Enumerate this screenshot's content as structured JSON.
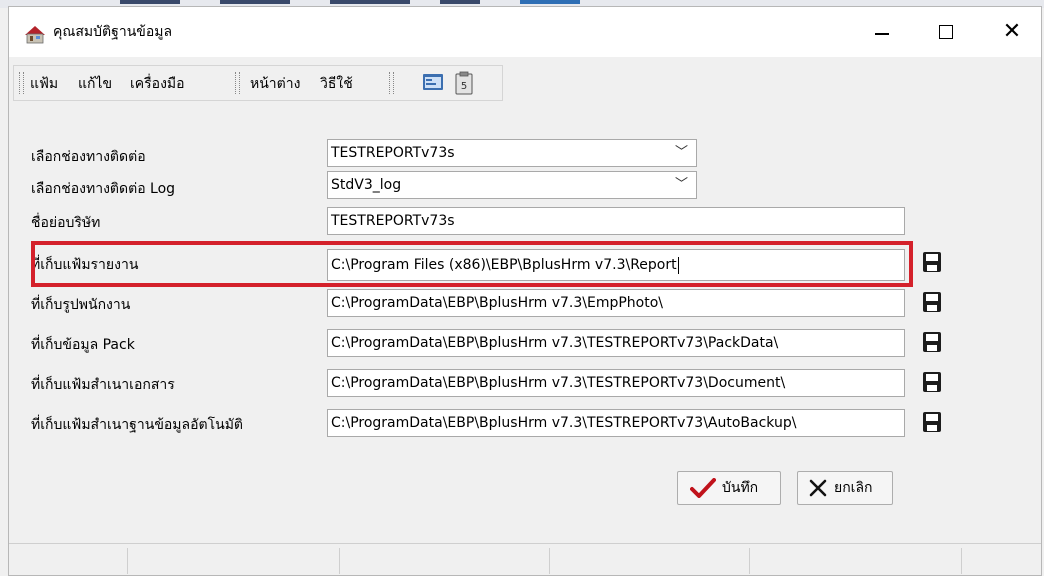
{
  "window": {
    "title": "คุณสมบัติฐานข้อมูล"
  },
  "menu": {
    "items": [
      "แฟ้ม",
      "แก้ไข",
      "เครื่องมือ",
      "หน้าต่าง",
      "วิธีใช้"
    ],
    "icons": [
      "window-icon",
      "clipboard-icon"
    ]
  },
  "form": {
    "connection": {
      "label": "เลือกช่องทางติดต่อ",
      "value": "TESTREPORTv73s"
    },
    "log_connection": {
      "label": "เลือกช่องทางติดต่อ Log",
      "value": "StdV3_log"
    },
    "company_short_name": {
      "label": "ชื่อย่อบริษัท",
      "value": "TESTREPORTv73s"
    },
    "report_folder": {
      "label": "ที่เก็บแฟ้มรายงาน",
      "value": "C:\\Program Files (x86)\\EBP\\BplusHrm v7.3\\Report"
    },
    "employee_photo_folder": {
      "label": "ที่เก็บรูปพนักงาน",
      "value": "C:\\ProgramData\\EBP\\BplusHrm v7.3\\EmpPhoto\\"
    },
    "pack_data_folder": {
      "label": "ที่เก็บข้อมูล Pack",
      "value": "C:\\ProgramData\\EBP\\BplusHrm v7.3\\TESTREPORTv73\\PackData\\"
    },
    "document_copy_folder": {
      "label": "ที่เก็บแฟ้มสำเนาเอกสาร",
      "value": "C:\\ProgramData\\EBP\\BplusHrm v7.3\\TESTREPORTv73\\Document\\"
    },
    "auto_backup_folder": {
      "label": "ที่เก็บแฟ้มสำเนาฐานข้อมูลอัตโนมัติ",
      "value": "C:\\ProgramData\\EBP\\BplusHrm v7.3\\TESTREPORTv73\\AutoBackup\\"
    }
  },
  "buttons": {
    "save": "บันทึก",
    "cancel": "ยกเลิก"
  },
  "colors": {
    "highlight": "#d4212b",
    "save_check": "#c0121b"
  }
}
